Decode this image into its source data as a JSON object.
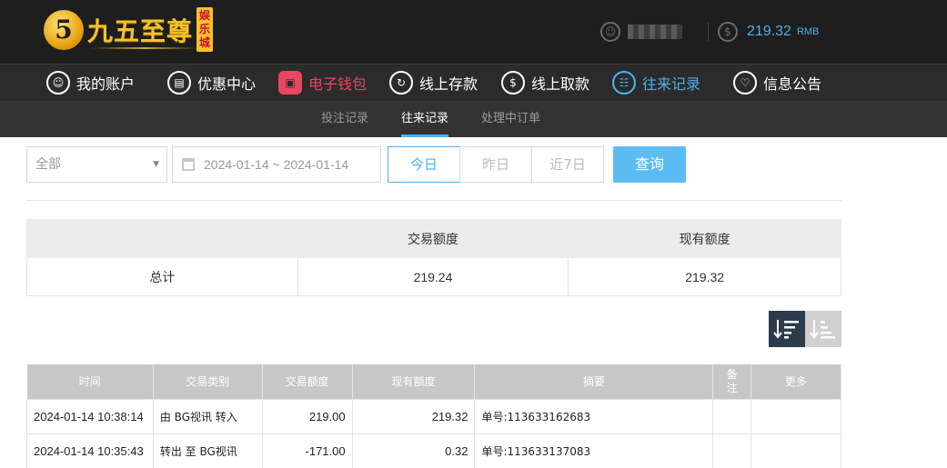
{
  "header": {
    "logo_char": "5",
    "logo_text": "九五至尊",
    "logo_badge": [
      "娱",
      "乐",
      "城"
    ],
    "balance": "219.32",
    "balance_unit": "RMB",
    "user_icon": "user-icon",
    "money_icon": "dollar-circle-icon"
  },
  "nav": {
    "items": [
      {
        "label": "我的账户",
        "icon": "user-icon"
      },
      {
        "label": "优惠中心",
        "icon": "gift-icon"
      },
      {
        "label": "电子钱包",
        "icon": "wallet-icon"
      },
      {
        "label": "线上存款",
        "icon": "deposit-icon"
      },
      {
        "label": "线上取款",
        "icon": "withdraw-icon"
      },
      {
        "label": "往来记录",
        "icon": "record-icon"
      },
      {
        "label": "信息公告",
        "icon": "bell-icon"
      }
    ]
  },
  "subnav": {
    "items": [
      "投注记录",
      "往来记录",
      "处理中订单"
    ]
  },
  "filters": {
    "type_selected": "全部",
    "date_range": "2024-01-14 ~ 2024-01-14",
    "quick": [
      "今日",
      "昨日",
      "近7日"
    ],
    "search_label": "查询"
  },
  "summary": {
    "headers": [
      "",
      "交易额度",
      "现有额度"
    ],
    "row_label": "总计",
    "amount": "219.24",
    "balance": "219.32"
  },
  "records": {
    "headers": [
      "时间",
      "交易类别",
      "交易额度",
      "现有额度",
      "摘要",
      "备\n注",
      "更多"
    ],
    "rows": [
      {
        "time": "2024-01-14 10:38:14",
        "type": "由 BG视讯 转入",
        "amount": "219.00",
        "balance": "219.32",
        "summary": "单号:113633162683",
        "remark": "",
        "more": ""
      },
      {
        "time": "2024-01-14 10:35:43",
        "type": "转出 至 BG视讯",
        "amount": "-171.00",
        "balance": "0.32",
        "summary": "单号:113633137083",
        "remark": "",
        "more": ""
      }
    ]
  },
  "colors": {
    "accent": "#4db0ef",
    "active_red": "#e9475f",
    "gold": "#f5c22c"
  }
}
